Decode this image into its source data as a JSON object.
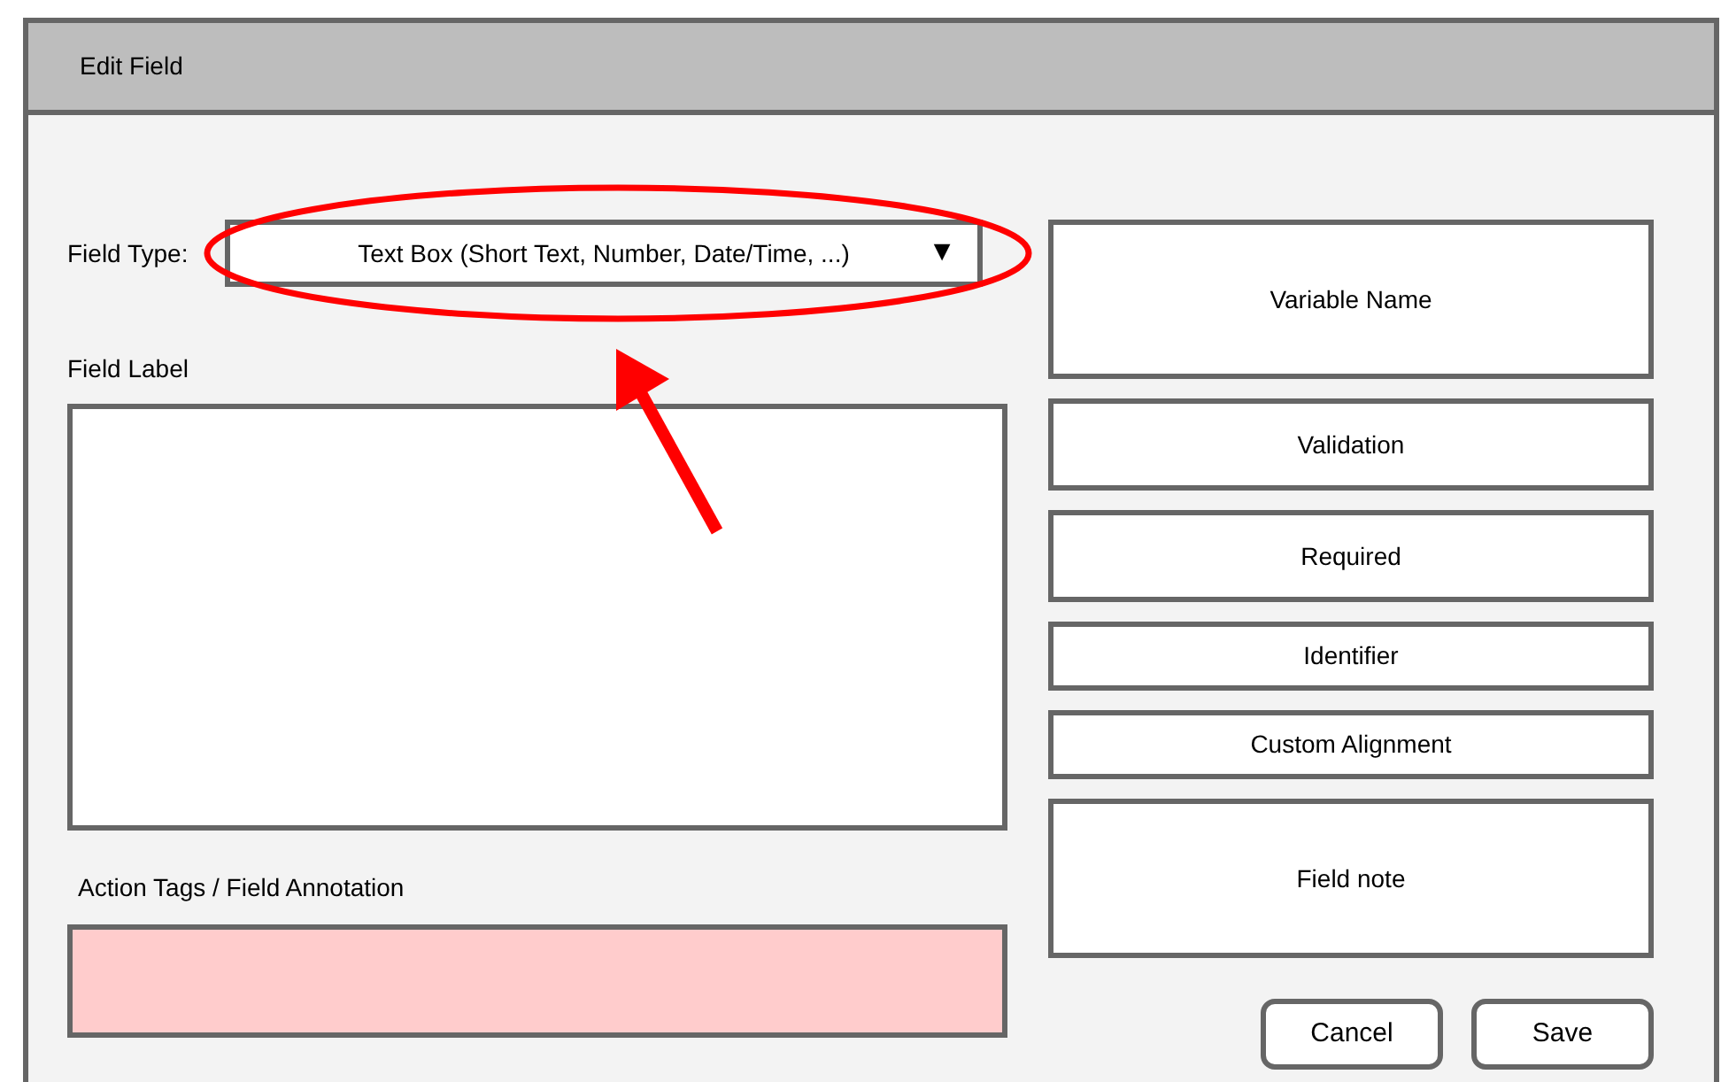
{
  "window": {
    "title": "Edit Field"
  },
  "field_type": {
    "label": "Field Type:",
    "value": "Text Box (Short Text, Number, Date/Time, ...)",
    "caret": "▼"
  },
  "field_label": {
    "label": "Field Label"
  },
  "action_tags": {
    "label": "Action Tags / Field Annotation"
  },
  "options": [
    {
      "label": "Variable Name"
    },
    {
      "label": "Validation"
    },
    {
      "label": "Required"
    },
    {
      "label": "Identifier"
    },
    {
      "label": "Custom Alignment"
    },
    {
      "label": "Field note"
    }
  ],
  "buttons": [
    "Cancel",
    "Save"
  ]
}
